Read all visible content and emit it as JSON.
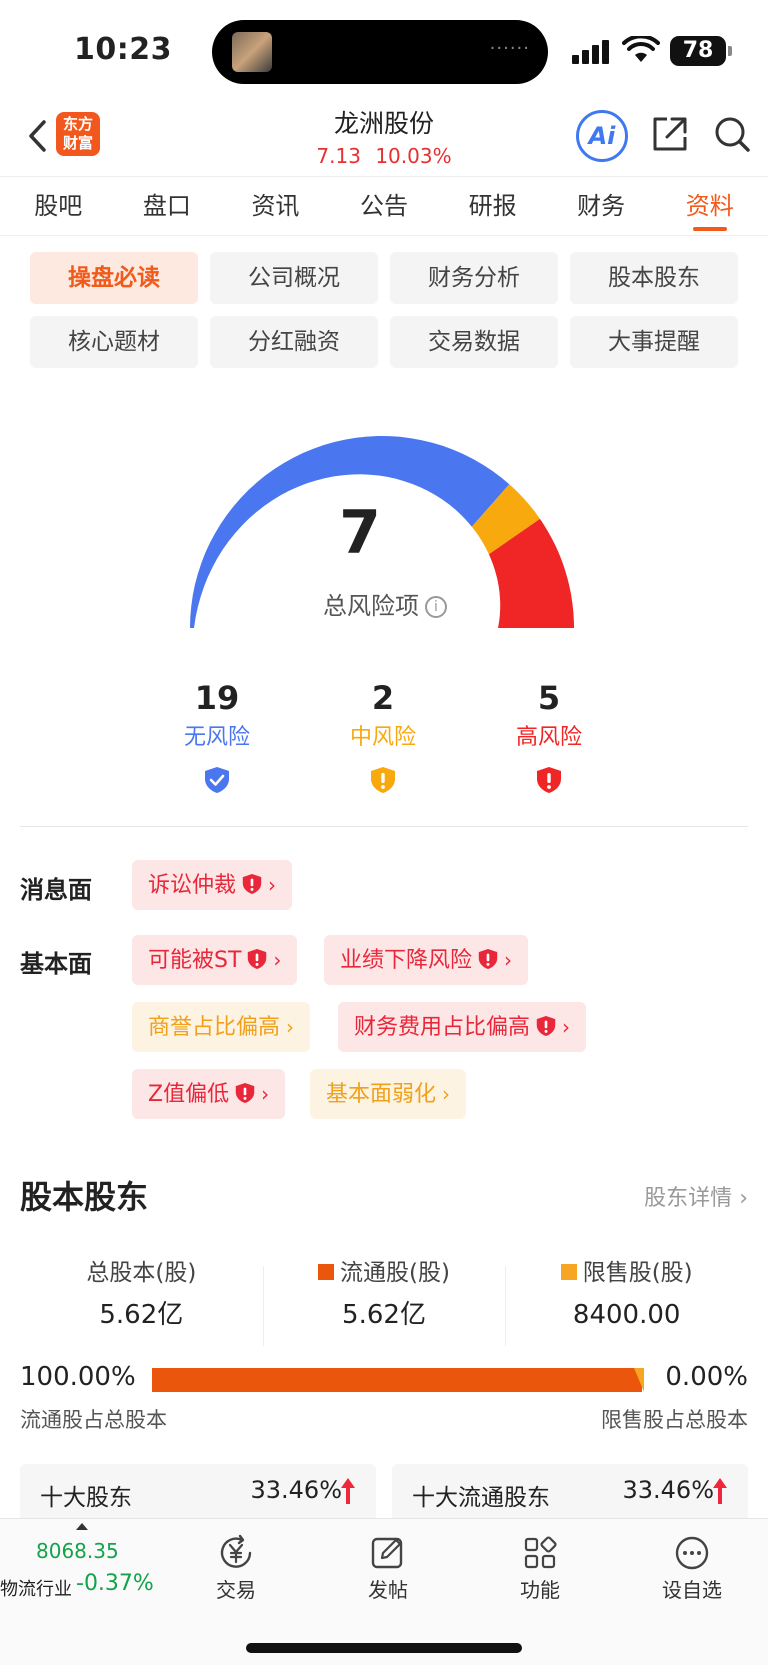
{
  "status": {
    "time": "10:23",
    "battery": "78"
  },
  "header": {
    "logo_line1": "东方",
    "logo_line2": "财富",
    "title": "龙洲股份",
    "price": "7.13",
    "change_pct": "10.03%",
    "ai_label": "Ai",
    "colors": {
      "up": "#e93030",
      "accent": "#f05a1a"
    }
  },
  "tabs": [
    "股吧",
    "盘口",
    "资讯",
    "公告",
    "研报",
    "财务",
    "资料"
  ],
  "active_tab": "资料",
  "submenu": [
    "操盘必读",
    "公司概况",
    "财务分析",
    "股本股东",
    "核心题材",
    "分红融资",
    "交易数据",
    "大事提醒"
  ],
  "active_submenu": "操盘必读",
  "risk": {
    "total": "7",
    "total_label": "总风险项",
    "none_count": "19",
    "none_label": "无风险",
    "mid_count": "2",
    "mid_label": "中风险",
    "high_count": "5",
    "high_label": "高风险",
    "colors": {
      "none": "#4a76f0",
      "mid": "#f8a90d",
      "high": "#f02626"
    }
  },
  "tags": {
    "news_label": "消息面",
    "news": [
      {
        "text": "诉讼仲裁",
        "level": "high"
      }
    ],
    "fundamental_label": "基本面",
    "fundamental": [
      {
        "text": "可能被ST",
        "level": "high"
      },
      {
        "text": "业绩下降风险",
        "level": "high"
      },
      {
        "text": "商誉占比偏高",
        "level": "mid"
      },
      {
        "text": "财务费用占比偏高",
        "level": "high"
      },
      {
        "text": "Z值偏低",
        "level": "high"
      },
      {
        "text": "基本面弱化",
        "level": "mid"
      }
    ]
  },
  "shareholders": {
    "title": "股本股东",
    "detail_link": "股东详情",
    "total_label": "总股本(股)",
    "total_value": "5.62亿",
    "float_label": "流通股(股)",
    "float_value": "5.62亿",
    "restricted_label": "限售股(股)",
    "restricted_value": "8400.00",
    "float_pct": "100.00%",
    "restricted_pct": "0.00%",
    "float_ratio": 0.995,
    "float_pct_label": "流通股占总股本",
    "restricted_pct_label": "限售股占总股本",
    "top10_title": "十大股东",
    "top10_pct": "33.46%",
    "top10_float_title": "十大流通股东",
    "top10_float_pct": "33.46%",
    "colors": {
      "float": "#e9560c",
      "restricted": "#f6a623"
    }
  },
  "bottom_bar": {
    "index_value": "8068.35",
    "index_name": "物流行业",
    "index_change": "-0.37%",
    "nav": [
      "交易",
      "发帖",
      "功能",
      "设自选"
    ]
  }
}
